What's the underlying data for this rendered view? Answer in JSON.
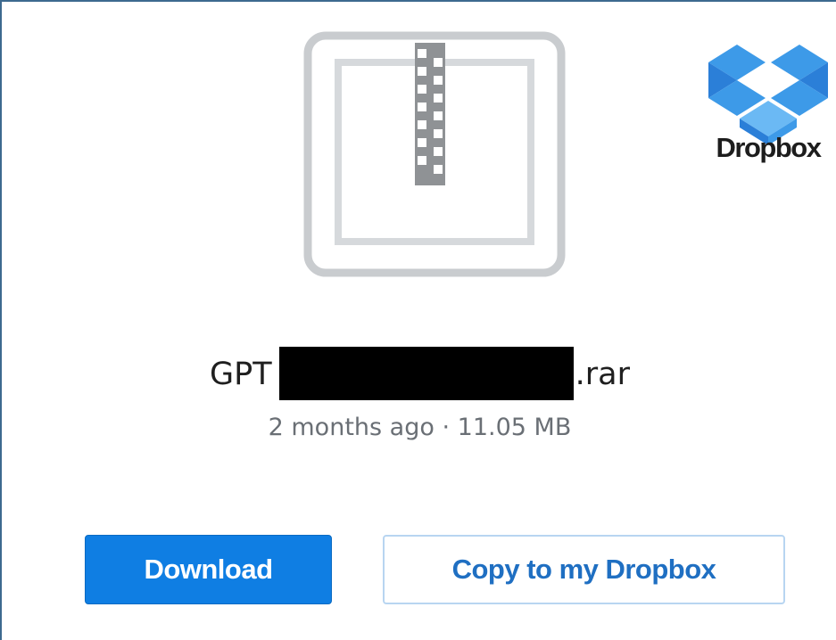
{
  "file": {
    "name_prefix": "GPT",
    "name_suffix": ".rar",
    "modified": "2 months ago",
    "separator": "·",
    "size": "11.05 MB",
    "icon": "zip-archive-icon"
  },
  "brand": {
    "name": "Dropbox",
    "logo_icon": "dropbox-box-icon",
    "logo_colors": [
      "#3d9ae8",
      "#2b7fd8",
      "#6bb9f4"
    ]
  },
  "actions": {
    "download_label": "Download",
    "copy_label": "Copy to my Dropbox"
  },
  "colors": {
    "primary_button": "#0f7ee3",
    "secondary_text": "#1f6fc2",
    "secondary_border": "#b8d5f1",
    "window_border": "#3d6a8f"
  }
}
